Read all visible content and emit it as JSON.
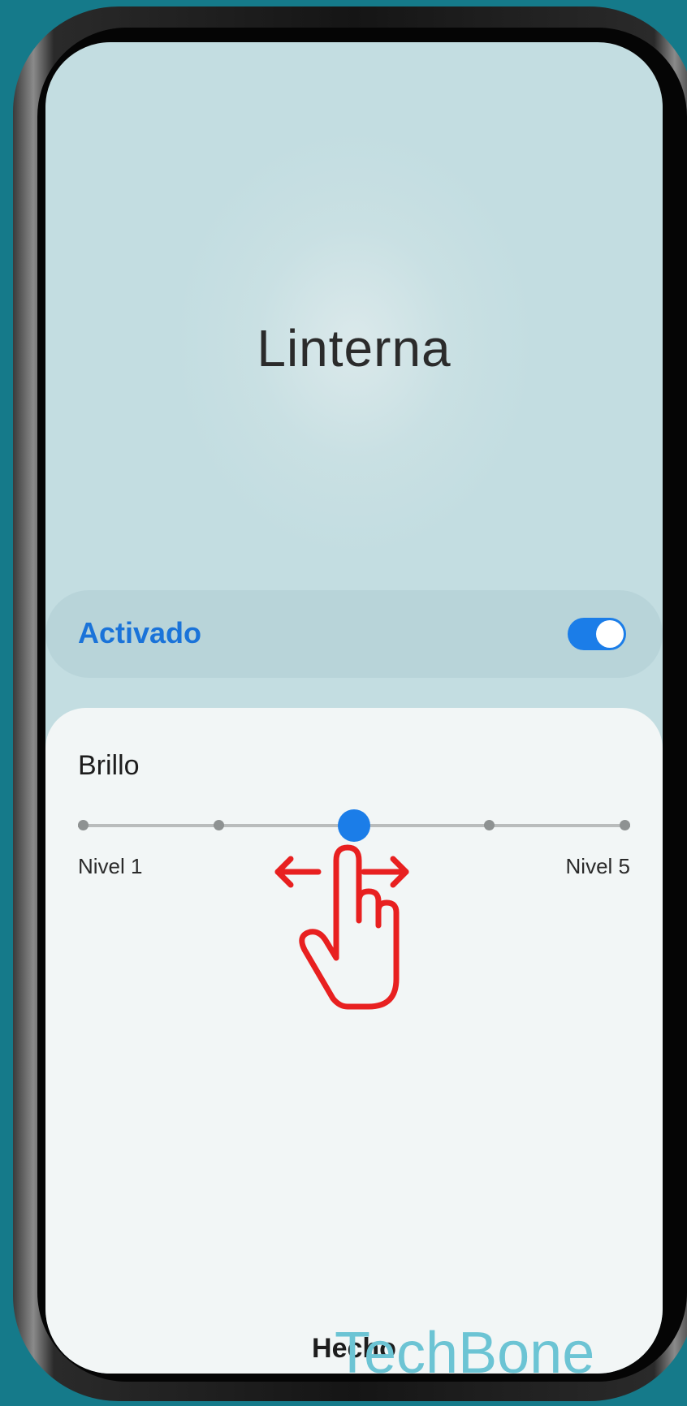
{
  "screen": {
    "title": "Linterna"
  },
  "toggle": {
    "label": "Activado",
    "state": "on",
    "accent_color": "#1b7de8"
  },
  "brightness": {
    "title": "Brillo",
    "levels": 5,
    "current_level": 3,
    "min_label": "Nivel 1",
    "max_label": "Nivel 5"
  },
  "footer": {
    "done_label": "Hecho"
  },
  "overlay": {
    "gesture_icon": "swipe-horizontal-hand-icon",
    "gesture_color": "#e82020",
    "watermark_text": "TechBone"
  }
}
